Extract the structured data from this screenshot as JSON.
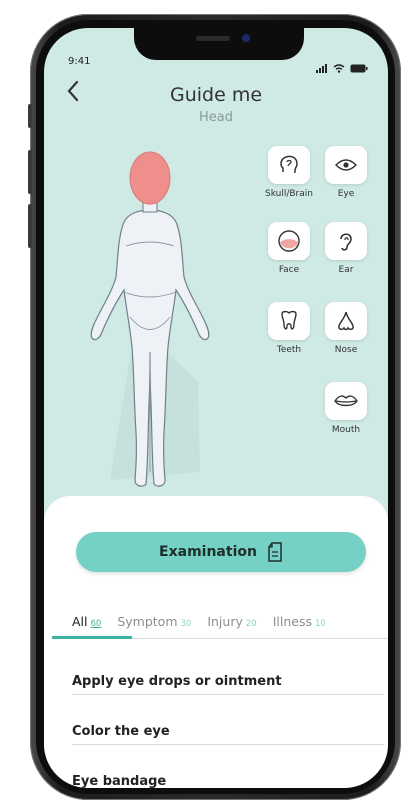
{
  "status": {
    "time": "9:41"
  },
  "header": {
    "back_icon": "chevron-left-icon",
    "title": "Guide me",
    "subtitle": "Head"
  },
  "body_parts": [
    {
      "label": "Skull/Brain",
      "icon": "brain-icon"
    },
    {
      "label": "Eye",
      "icon": "eye-icon"
    },
    {
      "label": "Face",
      "icon": "face-icon"
    },
    {
      "label": "Ear",
      "icon": "ear-icon"
    },
    {
      "label": "Teeth",
      "icon": "tooth-icon"
    },
    {
      "label": "Nose",
      "icon": "nose-icon"
    },
    {
      "label": "Mouth",
      "icon": "lips-icon"
    }
  ],
  "examination_button": {
    "label": "Examination",
    "icon": "document-icon"
  },
  "tabs": [
    {
      "label": "All",
      "count": "60",
      "active": true
    },
    {
      "label": "Symptom",
      "count": "30",
      "active": false
    },
    {
      "label": "Injury",
      "count": "20",
      "active": false
    },
    {
      "label": "Illness",
      "count": "10",
      "active": false
    }
  ],
  "items": [
    "Apply eye drops or ointment",
    "Color the eye",
    "Eye bandage"
  ],
  "colors": {
    "background": "#cfe9e4",
    "accent": "#74d1c3",
    "head_highlight": "#ef8f8c",
    "tab_accent": "#3fb3a3"
  }
}
